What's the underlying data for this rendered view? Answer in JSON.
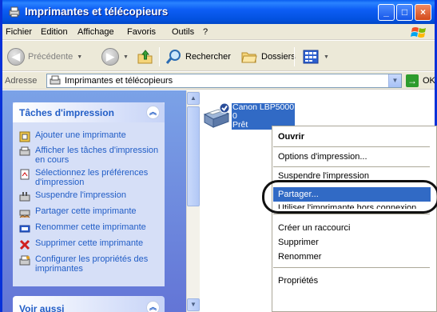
{
  "window": {
    "title": "Imprimantes et télécopieurs"
  },
  "titlebar_buttons": {
    "minimize": "_",
    "maximize": "□",
    "close": "×"
  },
  "menu": [
    {
      "label": "Fichier"
    },
    {
      "label": "Edition"
    },
    {
      "label": "Affichage"
    },
    {
      "label": "Favoris"
    },
    {
      "label": "Outils"
    },
    {
      "label": "?"
    }
  ],
  "toolbar": {
    "back_label": "Précédente",
    "search_label": "Rechercher",
    "folders_label": "Dossiers"
  },
  "address": {
    "label": "Adresse",
    "value": "Imprimantes et télécopieurs",
    "go_label": "OK"
  },
  "task_panel": {
    "title": "Tâches d'impression",
    "tasks": [
      {
        "label": "Ajouter une imprimante"
      },
      {
        "label": "Afficher les tâches d'impression en cours"
      },
      {
        "label": "Sélectionnez les préférences d'impression"
      },
      {
        "label": "Suspendre l'impression"
      },
      {
        "label": "Partager cette imprimante"
      },
      {
        "label": "Renommer cette imprimante"
      },
      {
        "label": "Supprimer cette imprimante"
      },
      {
        "label": "Configurer les propriétés des imprimantes"
      }
    ]
  },
  "see_also": {
    "title": "Voir aussi"
  },
  "printer": {
    "name": "Canon LBP5000",
    "documents": "0",
    "status": "Prêt"
  },
  "context_menu": {
    "items": [
      {
        "label": "Ouvrir",
        "bold": true
      },
      {
        "label": "Options d'impression..."
      },
      {
        "label": "Suspendre l'impression"
      },
      {
        "label": "Partager...",
        "highlighted": true
      },
      {
        "label": "Utiliser l'imprimante hors connexion"
      },
      {
        "label": "Créer un raccourci"
      },
      {
        "label": "Supprimer"
      },
      {
        "label": "Renommer"
      },
      {
        "label": "Propriétés"
      }
    ]
  },
  "colors": {
    "accent": "#316ac5",
    "titlebar": "#0a5ef0",
    "task_link": "#215dc6",
    "panel_bg": "#d6dff7"
  }
}
